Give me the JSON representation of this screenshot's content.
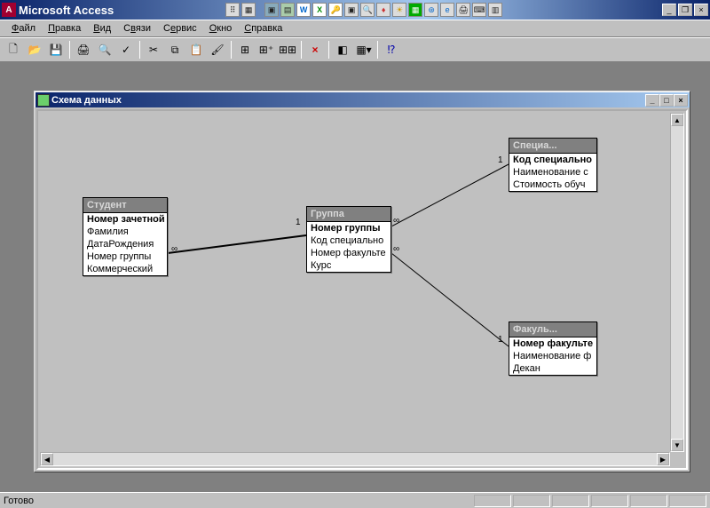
{
  "app": {
    "title": "Microsoft Access",
    "status": "Готово"
  },
  "menubar": {
    "file": "Файл",
    "edit": "Правка",
    "view": "Вид",
    "relations": "Связи",
    "service": "Сервис",
    "window": "Окно",
    "help": "Справка"
  },
  "child": {
    "title": "Схема данных",
    "min": "_",
    "max": "□",
    "close": "×"
  },
  "labels": {
    "one": "1",
    "many": "∞"
  },
  "tables": {
    "student": {
      "title": "Студент",
      "fields": [
        {
          "name": "Номер зачетной",
          "pk": true
        },
        {
          "name": "Фамилия",
          "pk": false
        },
        {
          "name": "ДатаРождения",
          "pk": false
        },
        {
          "name": "Номер группы",
          "pk": false
        },
        {
          "name": "Коммерческий",
          "pk": false
        }
      ]
    },
    "group": {
      "title": "Группа",
      "fields": [
        {
          "name": "Номер группы",
          "pk": true
        },
        {
          "name": "Код специально",
          "pk": false
        },
        {
          "name": "Номер факульте",
          "pk": false
        },
        {
          "name": "Курс",
          "pk": false
        }
      ]
    },
    "speciality": {
      "title": "Специа...",
      "fields": [
        {
          "name": "Код специально",
          "pk": true
        },
        {
          "name": "Наименование с",
          "pk": false
        },
        {
          "name": "Стоимость обуч",
          "pk": false
        }
      ]
    },
    "faculty": {
      "title": "Факуль...",
      "fields": [
        {
          "name": "Номер факульте",
          "pk": true
        },
        {
          "name": "Наименование ф",
          "pk": false
        },
        {
          "name": "Декан",
          "pk": false
        }
      ]
    }
  }
}
